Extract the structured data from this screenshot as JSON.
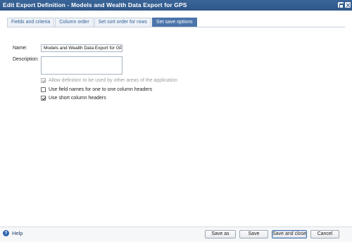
{
  "window": {
    "title": "Edit Export Definition - Models and Wealth Data Export for GPS",
    "maximize_icon": "maximize-icon",
    "close_icon": "close-icon"
  },
  "tabs": [
    {
      "label": "Fields and criteria",
      "active": false
    },
    {
      "label": "Column order",
      "active": false
    },
    {
      "label": "Set sort order for rows",
      "active": false
    },
    {
      "label": "Set save options",
      "active": true
    }
  ],
  "form": {
    "name_label": "Name:",
    "name_value": "Models and Wealth Data Export for GPS",
    "description_label": "Description:",
    "description_value": ""
  },
  "options": [
    {
      "label": "Allow definition to be used by other areas of the application",
      "checked": true,
      "disabled": true
    },
    {
      "label": "Use field names for one to one column headers",
      "checked": false,
      "disabled": false
    },
    {
      "label": "Use short column headers",
      "checked": true,
      "disabled": false
    }
  ],
  "footer": {
    "help_icon": "help-icon",
    "help_glyph": "?",
    "help_label": "Help",
    "save_as_label": "Save as",
    "save_label": "Save",
    "save_close_label": "Save and close",
    "cancel_label": "Cancel"
  },
  "colors": {
    "titlebar": "#2e578a",
    "active_tab": "#4a74aa",
    "link_text": "#2f5f99"
  }
}
